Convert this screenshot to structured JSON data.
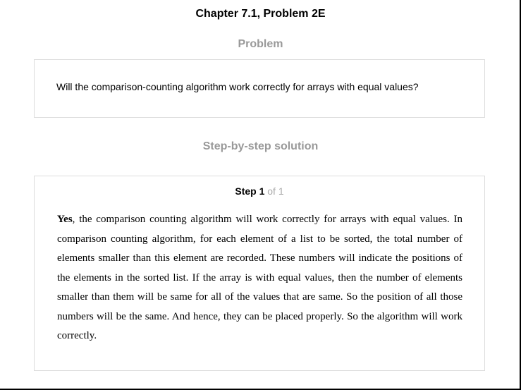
{
  "header": {
    "title": "Chapter 7.1, Problem 2E"
  },
  "problem": {
    "heading": "Problem",
    "text": "Will the comparison-counting algorithm work correctly for arrays with equal values?"
  },
  "solution": {
    "heading": "Step-by-step solution",
    "step": {
      "label": "Step 1",
      "of_text": "of 1",
      "answer_word": "Yes",
      "body": ", the comparison counting algorithm will work correctly for arrays with equal values. In comparison counting algorithm, for each element of a list to be sorted, the total number of elements smaller than this element are recorded. These numbers will indicate the positions of the elements in the sorted list. If the array is with equal values, then the number of elements smaller than them will be same for all of the values that are same. So the position of all those numbers will be the same. And hence, they can be placed properly. So the algorithm will work correctly."
    }
  }
}
